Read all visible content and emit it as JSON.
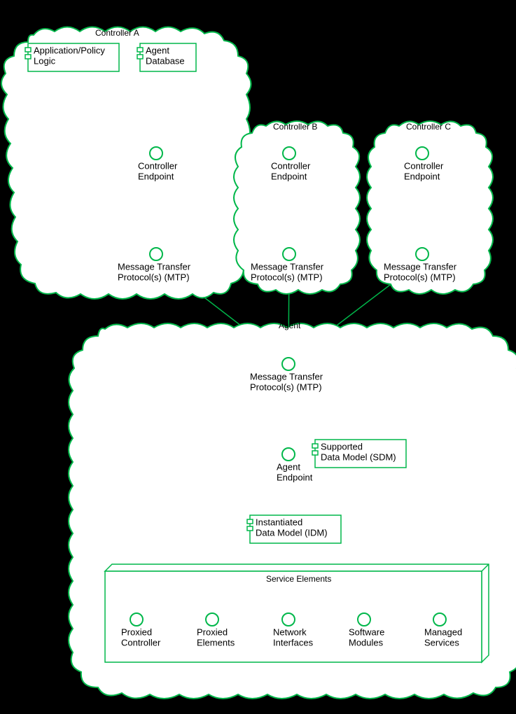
{
  "controllers": [
    {
      "title": "Controller A",
      "app_box1": "Application/Policy",
      "app_box2": "Logic",
      "db_box1": "Agent",
      "db_box2": "Database",
      "endpoint1": "Controller",
      "endpoint2": "Endpoint",
      "mtp1": "Message Transfer",
      "mtp2": "Protocol(s) (MTP)"
    },
    {
      "title": "Controller B",
      "endpoint1": "Controller",
      "endpoint2": "Endpoint",
      "mtp1": "Message Transfer",
      "mtp2": "Protocol(s) (MTP)"
    },
    {
      "title": "Controller C",
      "endpoint1": "Controller",
      "endpoint2": "Endpoint",
      "mtp1": "Message Transfer",
      "mtp2": "Protocol(s) (MTP)"
    }
  ],
  "agent": {
    "title": "Agent",
    "mtp1": "Message Transfer",
    "mtp2": "Protocol(s) (MTP)",
    "sdm1": "Supported",
    "sdm2": "Data Model (SDM)",
    "endpoint1": "Agent",
    "endpoint2": "Endpoint",
    "idm1": "Instantiated",
    "idm2": "Data Model (IDM)",
    "service_elements_title": "Service Elements",
    "elems": [
      {
        "l1": "Proxied",
        "l2": "Controller"
      },
      {
        "l1": "Proxied",
        "l2": "Elements"
      },
      {
        "l1": "Network",
        "l2": "Interfaces"
      },
      {
        "l1": "Software",
        "l2": "Modules"
      },
      {
        "l1": "Managed",
        "l2": "Services"
      }
    ]
  }
}
